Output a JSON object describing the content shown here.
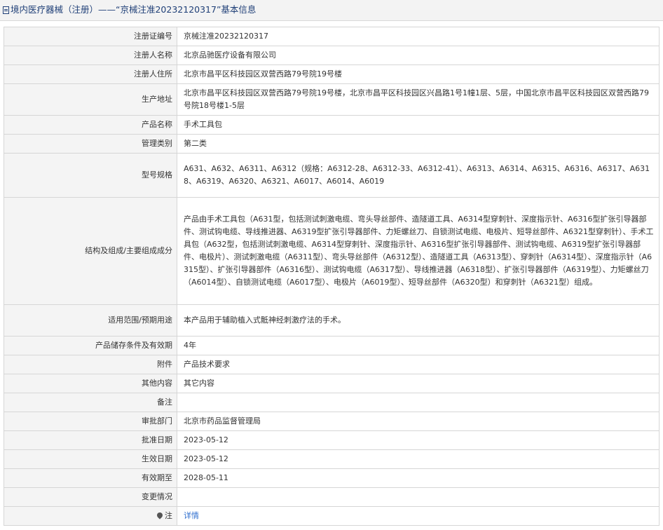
{
  "header": {
    "title": "境内医疗器械（注册）——“京械注准20232120317”基本信息"
  },
  "rows": [
    {
      "label": "注册证编号",
      "value": "京械注准20232120317"
    },
    {
      "label": "注册人名称",
      "value": "北京品驰医疗设备有限公司"
    },
    {
      "label": "注册人住所",
      "value": "北京市昌平区科技园区双营西路79号院19号楼"
    },
    {
      "label": "生产地址",
      "value": "北京市昌平区科技园区双营西路79号院19号楼，北京市昌平区科技园区兴昌路1号1幢1层、5层，中国北京市昌平区科技园区双营西路79号院18号楼1-5层"
    },
    {
      "label": "产品名称",
      "value": "手术工具包"
    },
    {
      "label": "管理类别",
      "value": "第二类"
    },
    {
      "label": "型号规格",
      "value": "A631、A632、A6311、A6312（规格：A6312-28、A6312-33、A6312-41）、A6313、A6314、A6315、A6316、A6317、A6318、A6319、A6320、A6321、A6017、A6014、A6019"
    },
    {
      "label": "结构及组成/主要组成成分",
      "value": "产品由手术工具包（A631型，包括测试刺激电缆、弯头导丝部件、造隧道工具、A6314型穿刺针、深度指示针、A6316型扩张引导器部件、测试钩电缆、导线推进器、A6319型扩张引导器部件、力矩螺丝刀、自锁测试电缆、电极片、短导丝部件、A6321型穿刺针）、手术工具包（A632型，包括测试刺激电缆、A6314型穿刺针、深度指示针、A6316型扩张引导器部件、测试钩电缆、A6319型扩张引导器部件、电极片）、测试刺激电缆（A6311型）、弯头导丝部件（A6312型）、造隧道工具（A6313型）、穿刺针（A6314型）、深度指示针（A6315型）、扩张引导器部件（A6316型）、测试钩电缆（A6317型）、导线推进器（A6318型）、扩张引导器部件（A6319型）、力矩螺丝刀（A6014型）、自锁测试电缆（A6017型）、电极片（A6019型）、短导丝部件（A6320型）和穿刺针（A6321型）组成。"
    },
    {
      "label": "适用范围/预期用途",
      "value": "本产品用于辅助植入式骶神经刺激疗法的手术。"
    },
    {
      "label": "产品储存条件及有效期",
      "value": "4年"
    },
    {
      "label": "附件",
      "value": "产品技术要求"
    },
    {
      "label": "其他内容",
      "value": "其它内容"
    },
    {
      "label": "备注",
      "value": ""
    },
    {
      "label": "审批部门",
      "value": "北京市药品监督管理局"
    },
    {
      "label": "批准日期",
      "value": "2023-05-12"
    },
    {
      "label": "生效日期",
      "value": "2023-05-12"
    },
    {
      "label": "有效期至",
      "value": "2028-05-11"
    },
    {
      "label": "变更情况",
      "value": ""
    }
  ],
  "note": {
    "label": "注",
    "link_text": "详情",
    "icon": "pin-icon"
  }
}
